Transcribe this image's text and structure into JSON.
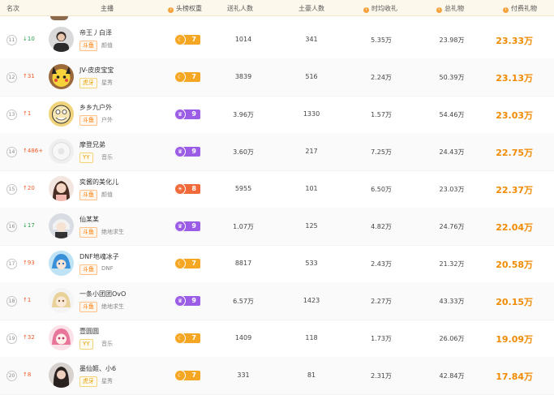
{
  "header": {
    "rank": "名次",
    "streamer": "主播",
    "head_weight": "头榜权重",
    "gift_users": "送礼人数",
    "tyrant_users": "土豪人数",
    "avg_gift": "时均收礼",
    "total_gift": "总礼物",
    "paid_gift": "付费礼物"
  },
  "colors": {
    "accent": "#f08a00",
    "up": "#f05a28",
    "down": "#2e9e4f",
    "orange_badge": "#f5a623",
    "purple_badge": "#9b5de5",
    "red_badge": "#f06a3a"
  },
  "rows": [
    {
      "rank": "11",
      "trend": "↓10",
      "trend_dir": "down",
      "name": "帝王丿白泽",
      "platform": "斗鱼",
      "platform_color": "orange",
      "category": "颜值",
      "badge_level": "7",
      "badge_color": "orange",
      "badge_icon": "moon-icon",
      "gift_users": "1014",
      "tyrant_users": "341",
      "avg_gift": "5.35万",
      "total_gift": "23.98万",
      "paid_gift": "23.33万"
    },
    {
      "rank": "12",
      "trend": "↑31",
      "trend_dir": "up",
      "name": "JV-皮皮宝宝",
      "platform": "虎牙",
      "platform_color": "yellow",
      "category": "星秀",
      "badge_level": "7",
      "badge_color": "orange",
      "badge_icon": "moon-icon",
      "gift_users": "3839",
      "tyrant_users": "516",
      "avg_gift": "2.24万",
      "total_gift": "50.39万",
      "paid_gift": "23.13万"
    },
    {
      "rank": "13",
      "trend": "↑1",
      "trend_dir": "up",
      "name": "乡乡九户外",
      "platform": "斗鱼",
      "platform_color": "orange",
      "category": "户外",
      "badge_level": "9",
      "badge_color": "purple",
      "badge_icon": "crown-icon",
      "gift_users": "3.96万",
      "tyrant_users": "1330",
      "avg_gift": "1.57万",
      "total_gift": "54.46万",
      "paid_gift": "23.03万"
    },
    {
      "rank": "14",
      "trend": "↑486+",
      "trend_dir": "up",
      "name": "摩登兄弟",
      "platform": "YY",
      "platform_color": "yellow",
      "category": "音乐",
      "badge_level": "9",
      "badge_color": "purple",
      "badge_icon": "crown-icon",
      "gift_users": "3.60万",
      "tyrant_users": "217",
      "avg_gift": "7.25万",
      "total_gift": "24.43万",
      "paid_gift": "22.75万"
    },
    {
      "rank": "15",
      "trend": "↑20",
      "trend_dir": "up",
      "name": "奕酱的美化儿",
      "platform": "斗鱼",
      "platform_color": "orange",
      "category": "颜值",
      "badge_level": "8",
      "badge_color": "red",
      "badge_icon": "sun-icon",
      "gift_users": "5955",
      "tyrant_users": "101",
      "avg_gift": "6.50万",
      "total_gift": "23.03万",
      "paid_gift": "22.37万"
    },
    {
      "rank": "16",
      "trend": "↓17",
      "trend_dir": "down",
      "name": "仙某某",
      "platform": "斗鱼",
      "platform_color": "orange",
      "category": "绝地求生",
      "badge_level": "9",
      "badge_color": "purple",
      "badge_icon": "crown-icon",
      "gift_users": "1.07万",
      "tyrant_users": "125",
      "avg_gift": "4.82万",
      "total_gift": "24.76万",
      "paid_gift": "22.04万"
    },
    {
      "rank": "17",
      "trend": "↑93",
      "trend_dir": "up",
      "name": "DNF地魂冰子",
      "platform": "斗鱼",
      "platform_color": "orange",
      "category": "DNF",
      "badge_level": "7",
      "badge_color": "orange",
      "badge_icon": "moon-icon",
      "gift_users": "8817",
      "tyrant_users": "533",
      "avg_gift": "2.43万",
      "total_gift": "21.32万",
      "paid_gift": "20.58万"
    },
    {
      "rank": "18",
      "trend": "↑1",
      "trend_dir": "up",
      "name": "一条小团团OvO",
      "platform": "斗鱼",
      "platform_color": "orange",
      "category": "绝地求生",
      "badge_level": "9",
      "badge_color": "purple",
      "badge_icon": "crown-icon",
      "gift_users": "6.57万",
      "tyrant_users": "1423",
      "avg_gift": "2.27万",
      "total_gift": "43.33万",
      "paid_gift": "20.15万"
    },
    {
      "rank": "19",
      "trend": "↑32",
      "trend_dir": "up",
      "name": "壹圆圆",
      "platform": "YY",
      "platform_color": "yellow",
      "category": "音乐",
      "badge_level": "7",
      "badge_color": "orange",
      "badge_icon": "moon-icon",
      "gift_users": "1409",
      "tyrant_users": "118",
      "avg_gift": "1.73万",
      "total_gift": "26.06万",
      "paid_gift": "19.09万"
    },
    {
      "rank": "20",
      "trend": "↑8",
      "trend_dir": "up",
      "name": "墨仙姬、小6",
      "platform": "虎牙",
      "platform_color": "yellow",
      "category": "星秀",
      "badge_level": "7",
      "badge_color": "orange",
      "badge_icon": "moon-icon",
      "gift_users": "331",
      "tyrant_users": "81",
      "avg_gift": "2.31万",
      "total_gift": "42.84万",
      "paid_gift": "17.84万"
    }
  ]
}
